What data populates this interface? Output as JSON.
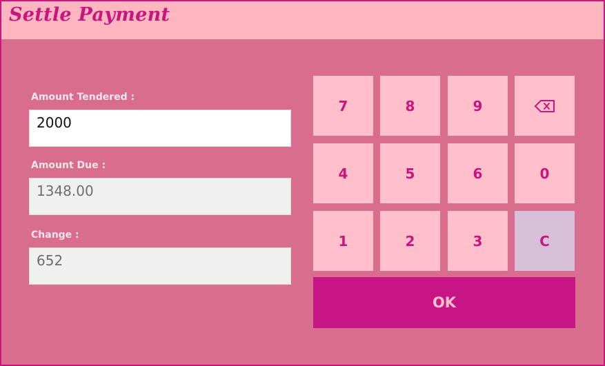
{
  "dialog": {
    "title": "Settle Payment"
  },
  "fields": {
    "tendered": {
      "label": "Amount Tendered :",
      "value": "2000"
    },
    "due": {
      "label": "Amount Due :",
      "value": "1348.00"
    },
    "change": {
      "label": "Change :",
      "value": "652"
    }
  },
  "keypad": {
    "k7": "7",
    "k8": "8",
    "k9": "9",
    "k4": "4",
    "k5": "5",
    "k6": "6",
    "k0": "0",
    "k1": "1",
    "k2": "2",
    "k3": "3",
    "clear": "C",
    "backspace_icon": "backspace-icon",
    "ok": "OK"
  },
  "colors": {
    "background": "#d96d8d",
    "titlebar": "#ffb6c1",
    "accent": "#c8167e",
    "key": "#ffc0cb",
    "clear_key": "#d8bfd8",
    "ok_key": "#c71585"
  }
}
